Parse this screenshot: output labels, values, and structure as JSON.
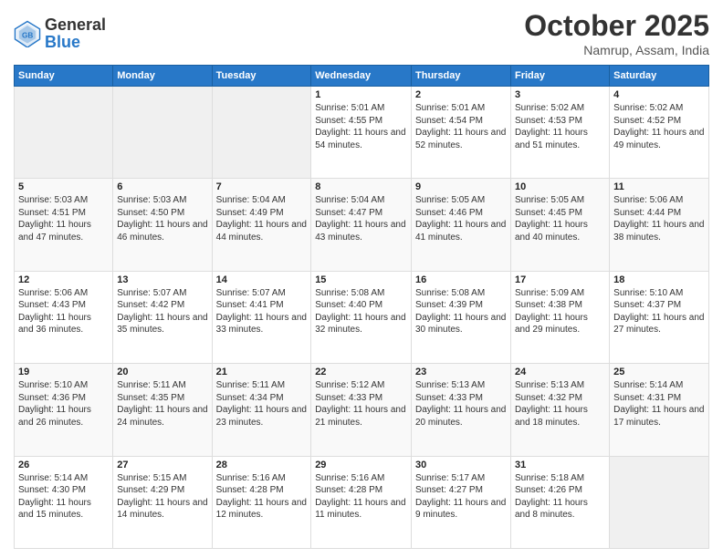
{
  "header": {
    "logo_general": "General",
    "logo_blue": "Blue",
    "month": "October 2025",
    "location": "Namrup, Assam, India"
  },
  "weekdays": [
    "Sunday",
    "Monday",
    "Tuesday",
    "Wednesday",
    "Thursday",
    "Friday",
    "Saturday"
  ],
  "weeks": [
    [
      {
        "day": "",
        "sunrise": "",
        "sunset": "",
        "daylight": ""
      },
      {
        "day": "",
        "sunrise": "",
        "sunset": "",
        "daylight": ""
      },
      {
        "day": "",
        "sunrise": "",
        "sunset": "",
        "daylight": ""
      },
      {
        "day": "1",
        "sunrise": "Sunrise: 5:01 AM",
        "sunset": "Sunset: 4:55 PM",
        "daylight": "Daylight: 11 hours and 54 minutes."
      },
      {
        "day": "2",
        "sunrise": "Sunrise: 5:01 AM",
        "sunset": "Sunset: 4:54 PM",
        "daylight": "Daylight: 11 hours and 52 minutes."
      },
      {
        "day": "3",
        "sunrise": "Sunrise: 5:02 AM",
        "sunset": "Sunset: 4:53 PM",
        "daylight": "Daylight: 11 hours and 51 minutes."
      },
      {
        "day": "4",
        "sunrise": "Sunrise: 5:02 AM",
        "sunset": "Sunset: 4:52 PM",
        "daylight": "Daylight: 11 hours and 49 minutes."
      }
    ],
    [
      {
        "day": "5",
        "sunrise": "Sunrise: 5:03 AM",
        "sunset": "Sunset: 4:51 PM",
        "daylight": "Daylight: 11 hours and 47 minutes."
      },
      {
        "day": "6",
        "sunrise": "Sunrise: 5:03 AM",
        "sunset": "Sunset: 4:50 PM",
        "daylight": "Daylight: 11 hours and 46 minutes."
      },
      {
        "day": "7",
        "sunrise": "Sunrise: 5:04 AM",
        "sunset": "Sunset: 4:49 PM",
        "daylight": "Daylight: 11 hours and 44 minutes."
      },
      {
        "day": "8",
        "sunrise": "Sunrise: 5:04 AM",
        "sunset": "Sunset: 4:47 PM",
        "daylight": "Daylight: 11 hours and 43 minutes."
      },
      {
        "day": "9",
        "sunrise": "Sunrise: 5:05 AM",
        "sunset": "Sunset: 4:46 PM",
        "daylight": "Daylight: 11 hours and 41 minutes."
      },
      {
        "day": "10",
        "sunrise": "Sunrise: 5:05 AM",
        "sunset": "Sunset: 4:45 PM",
        "daylight": "Daylight: 11 hours and 40 minutes."
      },
      {
        "day": "11",
        "sunrise": "Sunrise: 5:06 AM",
        "sunset": "Sunset: 4:44 PM",
        "daylight": "Daylight: 11 hours and 38 minutes."
      }
    ],
    [
      {
        "day": "12",
        "sunrise": "Sunrise: 5:06 AM",
        "sunset": "Sunset: 4:43 PM",
        "daylight": "Daylight: 11 hours and 36 minutes."
      },
      {
        "day": "13",
        "sunrise": "Sunrise: 5:07 AM",
        "sunset": "Sunset: 4:42 PM",
        "daylight": "Daylight: 11 hours and 35 minutes."
      },
      {
        "day": "14",
        "sunrise": "Sunrise: 5:07 AM",
        "sunset": "Sunset: 4:41 PM",
        "daylight": "Daylight: 11 hours and 33 minutes."
      },
      {
        "day": "15",
        "sunrise": "Sunrise: 5:08 AM",
        "sunset": "Sunset: 4:40 PM",
        "daylight": "Daylight: 11 hours and 32 minutes."
      },
      {
        "day": "16",
        "sunrise": "Sunrise: 5:08 AM",
        "sunset": "Sunset: 4:39 PM",
        "daylight": "Daylight: 11 hours and 30 minutes."
      },
      {
        "day": "17",
        "sunrise": "Sunrise: 5:09 AM",
        "sunset": "Sunset: 4:38 PM",
        "daylight": "Daylight: 11 hours and 29 minutes."
      },
      {
        "day": "18",
        "sunrise": "Sunrise: 5:10 AM",
        "sunset": "Sunset: 4:37 PM",
        "daylight": "Daylight: 11 hours and 27 minutes."
      }
    ],
    [
      {
        "day": "19",
        "sunrise": "Sunrise: 5:10 AM",
        "sunset": "Sunset: 4:36 PM",
        "daylight": "Daylight: 11 hours and 26 minutes."
      },
      {
        "day": "20",
        "sunrise": "Sunrise: 5:11 AM",
        "sunset": "Sunset: 4:35 PM",
        "daylight": "Daylight: 11 hours and 24 minutes."
      },
      {
        "day": "21",
        "sunrise": "Sunrise: 5:11 AM",
        "sunset": "Sunset: 4:34 PM",
        "daylight": "Daylight: 11 hours and 23 minutes."
      },
      {
        "day": "22",
        "sunrise": "Sunrise: 5:12 AM",
        "sunset": "Sunset: 4:33 PM",
        "daylight": "Daylight: 11 hours and 21 minutes."
      },
      {
        "day": "23",
        "sunrise": "Sunrise: 5:13 AM",
        "sunset": "Sunset: 4:33 PM",
        "daylight": "Daylight: 11 hours and 20 minutes."
      },
      {
        "day": "24",
        "sunrise": "Sunrise: 5:13 AM",
        "sunset": "Sunset: 4:32 PM",
        "daylight": "Daylight: 11 hours and 18 minutes."
      },
      {
        "day": "25",
        "sunrise": "Sunrise: 5:14 AM",
        "sunset": "Sunset: 4:31 PM",
        "daylight": "Daylight: 11 hours and 17 minutes."
      }
    ],
    [
      {
        "day": "26",
        "sunrise": "Sunrise: 5:14 AM",
        "sunset": "Sunset: 4:30 PM",
        "daylight": "Daylight: 11 hours and 15 minutes."
      },
      {
        "day": "27",
        "sunrise": "Sunrise: 5:15 AM",
        "sunset": "Sunset: 4:29 PM",
        "daylight": "Daylight: 11 hours and 14 minutes."
      },
      {
        "day": "28",
        "sunrise": "Sunrise: 5:16 AM",
        "sunset": "Sunset: 4:28 PM",
        "daylight": "Daylight: 11 hours and 12 minutes."
      },
      {
        "day": "29",
        "sunrise": "Sunrise: 5:16 AM",
        "sunset": "Sunset: 4:28 PM",
        "daylight": "Daylight: 11 hours and 11 minutes."
      },
      {
        "day": "30",
        "sunrise": "Sunrise: 5:17 AM",
        "sunset": "Sunset: 4:27 PM",
        "daylight": "Daylight: 11 hours and 9 minutes."
      },
      {
        "day": "31",
        "sunrise": "Sunrise: 5:18 AM",
        "sunset": "Sunset: 4:26 PM",
        "daylight": "Daylight: 11 hours and 8 minutes."
      },
      {
        "day": "",
        "sunrise": "",
        "sunset": "",
        "daylight": ""
      }
    ]
  ]
}
